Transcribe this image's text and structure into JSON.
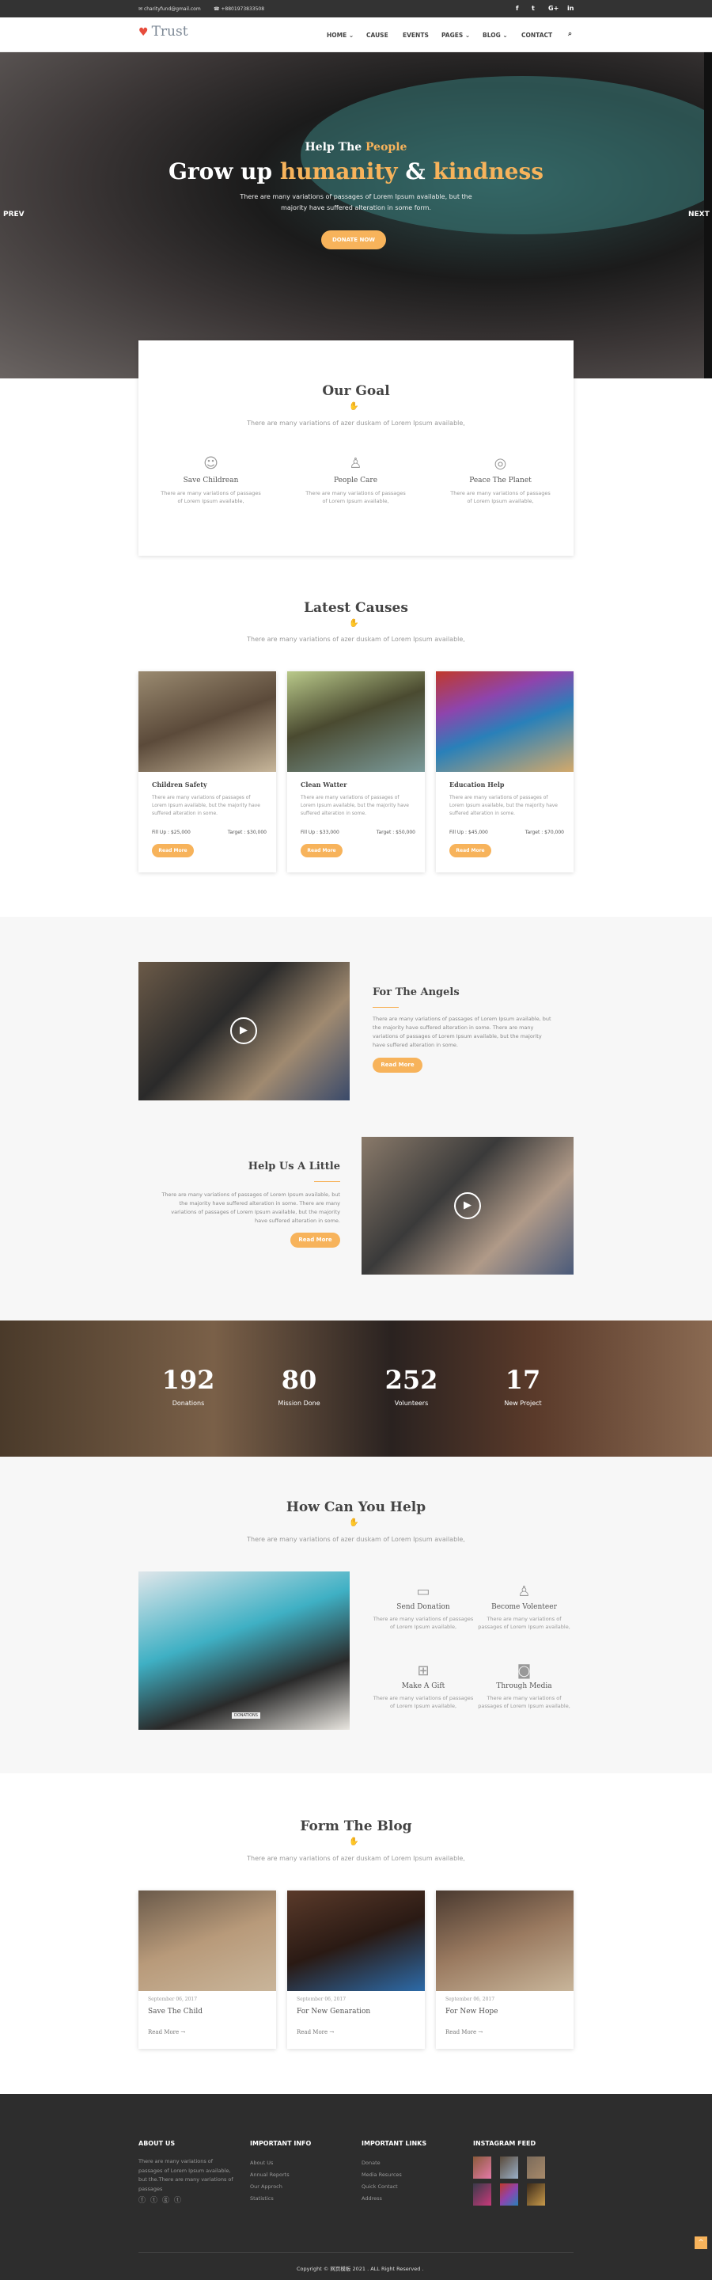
{
  "topbar": {
    "email": "charityfund@gmail.com",
    "phone": "+8801973833508",
    "social": [
      "f",
      "t",
      "G+",
      "in"
    ]
  },
  "nav": {
    "logo": "Trust",
    "items": [
      "HOME",
      "CAUSE",
      "EVENTS",
      "PAGES",
      "BLOG",
      "CONTACT"
    ],
    "dropdown": [
      true,
      false,
      false,
      true,
      true,
      false
    ]
  },
  "hero": {
    "kicker_a": "Help The",
    "kicker_b": "People",
    "title_a": "Grow up",
    "title_b": "humanity",
    "title_c": "&",
    "title_d": "kindness",
    "text": "There are many variations of passages of Lorem Ipsum available, but the majority have suffered alteration in some form.",
    "cta": "DONATE NOW",
    "prev": "PREV",
    "next": "NEXT"
  },
  "goal": {
    "title": "Our Goal",
    "subtitle": "There are many variations of azer duskam of Lorem Ipsum available,",
    "items": [
      {
        "icon": "smile-icon",
        "title": "Save Childrean",
        "text": "There are many variations of passages of Lorem Ipsum available,"
      },
      {
        "icon": "user-icon",
        "title": "People Care",
        "text": "There are many variations of passages of Lorem Ipsum available,"
      },
      {
        "icon": "globe-icon",
        "title": "Peace The Planet",
        "text": "There are many variations of passages of Lorem Ipsum available,"
      }
    ]
  },
  "causes": {
    "title": "Latest Causes",
    "subtitle": "There are many variations of azer duskam of Lorem Ipsum available,",
    "items": [
      {
        "title": "Children Safety",
        "text": "There are many variations of passages of Lorem Ipsum available, but the majority have suffered alteration in some.",
        "fill": "Fill Up : $25,000",
        "target": "Target : $30,000",
        "btn": "Read More"
      },
      {
        "title": "Clean Watter",
        "text": "There are many variations of passages of Lorem Ipsum available, but the majority have suffered alteration in some.",
        "fill": "Fill Up : $33,000",
        "target": "Target : $50,000",
        "btn": "Read More"
      },
      {
        "title": "Education Help",
        "text": "There are many variations of passages of Lorem Ipsum available, but the majority have suffered alteration in some.",
        "fill": "Fill Up : $45,000",
        "target": "Target : $70,000",
        "btn": "Read More"
      }
    ]
  },
  "features": [
    {
      "title": "For The Angels",
      "text": "There are many variations of passages of Lorem Ipsum available, but the majority have suffered alteration in some. There are many variations of passages of Lorem Ipsum available, but the majority have suffered alteration in some.",
      "btn": "Read More"
    },
    {
      "title": "Help Us A Little",
      "text": "There are many variations of passages of Lorem Ipsum available, but the majority have suffered alteration in some. There are many variations of passages of Lorem Ipsum available, but the majority have suffered alteration in some.",
      "btn": "Read More"
    }
  ],
  "counters": [
    {
      "value": "192",
      "label": "Donations"
    },
    {
      "value": "80",
      "label": "Mission Done"
    },
    {
      "value": "252",
      "label": "Volunteers"
    },
    {
      "value": "17",
      "label": "New Project"
    }
  ],
  "help": {
    "title": "How Can You Help",
    "subtitle": "There are many variations of azer duskam of Lorem Ipsum available,",
    "image_label": "DONATIONS",
    "items": [
      {
        "icon": "wallet-icon",
        "title": "Send Donation",
        "text": "There are many variations of passages of Lorem Ipsum available,"
      },
      {
        "icon": "user-icon",
        "title": "Become Volenteer",
        "text": "There are many variations of passages of Lorem Ipsum available,"
      },
      {
        "icon": "gift-icon",
        "title": "Make A Gift",
        "text": "There are many variations of passages of Lorem Ipsum available,"
      },
      {
        "icon": "camera-icon",
        "title": "Through Media",
        "text": "There are many variations of passages of Lorem Ipsum available,"
      }
    ]
  },
  "blog": {
    "title": "Form The Blog",
    "subtitle": "There are many variations of azer duskam of Lorem Ipsum available,",
    "posts": [
      {
        "date": "September 06, 2017",
        "title": "Save The Child",
        "more": "Read More"
      },
      {
        "date": "September 06, 2017",
        "title": "For New Genaration",
        "more": "Read More"
      },
      {
        "date": "September 06, 2017",
        "title": "For New Hope",
        "more": "Read More"
      }
    ]
  },
  "footer": {
    "about_title": "ABOUT US",
    "about_text": "There are many variations of passages of Lorem Ipsum available, but the.There are many variations of passages",
    "info_title": "IMPORTANT INFO",
    "info": [
      "About Us",
      "Annual Reports",
      "Our Approch",
      "Statistics"
    ],
    "links_title": "IMPORTANT LINKS",
    "links": [
      "Donate",
      "Media Resurces",
      "Quick Contact",
      "Address"
    ],
    "insta_title": "INSTAGRAM FEED",
    "copyright": "Copyright © 网页模板 2021 . ALL Right Reserved ."
  },
  "colors": {
    "accent": "#f7b35b",
    "dark": "#333333",
    "footer": "#2d2d2d"
  }
}
